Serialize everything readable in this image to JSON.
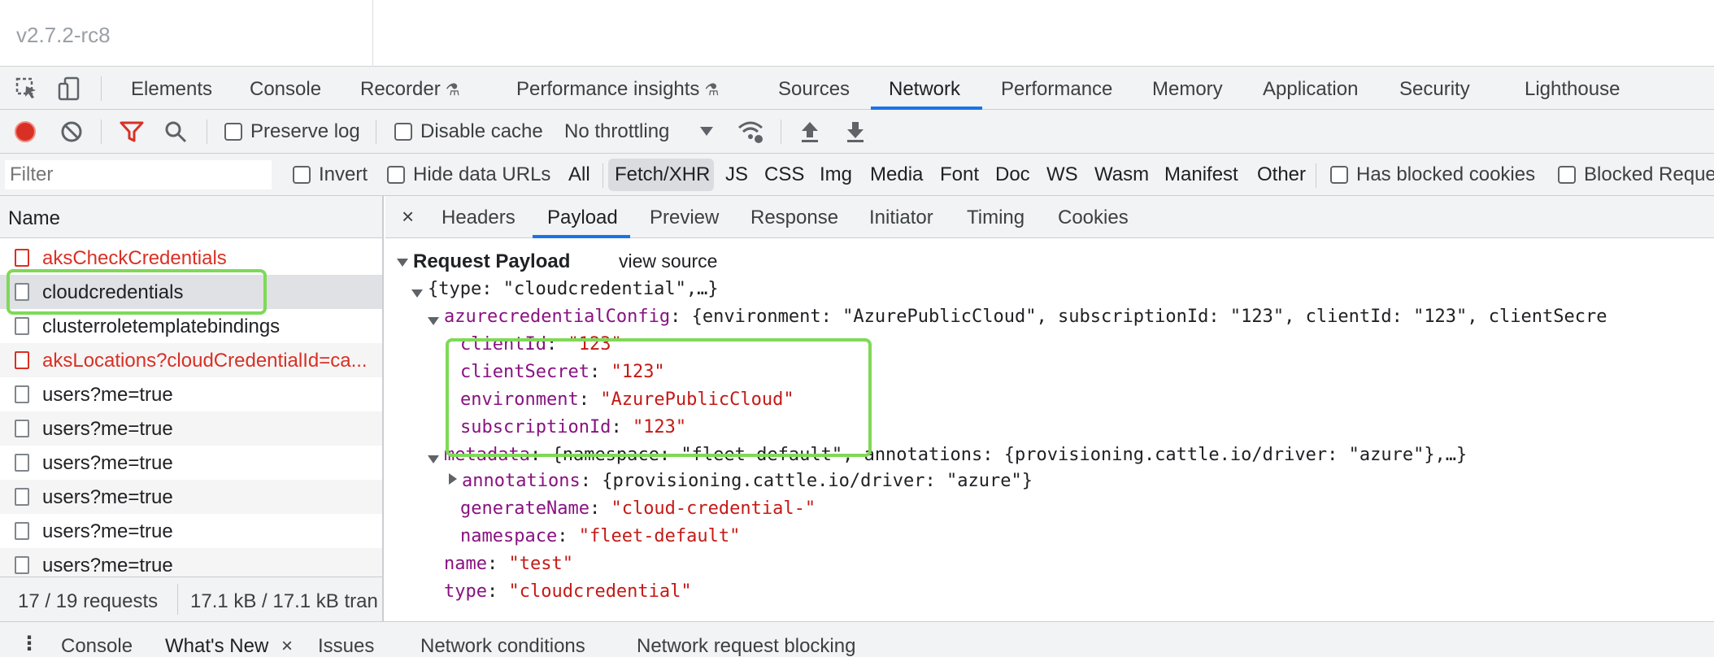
{
  "page": {
    "version": "v2.7.2-rc8"
  },
  "main_tabs": {
    "items": [
      "Elements",
      "Console",
      "Recorder",
      "Performance insights",
      "Sources",
      "Network",
      "Performance",
      "Memory",
      "Application",
      "Security",
      "Lighthouse"
    ],
    "active": "Network"
  },
  "toolbar": {
    "preserve_log": "Preserve log",
    "disable_cache": "Disable cache",
    "throttling": "No throttling"
  },
  "filter": {
    "placeholder": "Filter",
    "invert": "Invert",
    "hide_data_urls": "Hide data URLs",
    "types": [
      "All",
      "Fetch/XHR",
      "JS",
      "CSS",
      "Img",
      "Media",
      "Font",
      "Doc",
      "WS",
      "Wasm",
      "Manifest",
      "Other"
    ],
    "active_type": "Fetch/XHR",
    "has_blocked_cookies": "Has blocked cookies",
    "blocked_requests": "Blocked Reque"
  },
  "requests": {
    "header": "Name",
    "rows": [
      {
        "name": "aksCheckCredentials",
        "error": true
      },
      {
        "name": "cloudcredentials",
        "selected": true
      },
      {
        "name": "clusterroletemplatebindings"
      },
      {
        "name": "aksLocations?cloudCredentialId=ca...",
        "error": true
      },
      {
        "name": "users?me=true"
      },
      {
        "name": "users?me=true"
      },
      {
        "name": "users?me=true"
      },
      {
        "name": "users?me=true"
      },
      {
        "name": "users?me=true"
      },
      {
        "name": "users?me=true"
      }
    ],
    "status_count": "17 / 19 requests",
    "status_size": "17.1 kB / 17.1 kB tran"
  },
  "detail_tabs": {
    "close": "×",
    "items": [
      "Headers",
      "Payload",
      "Preview",
      "Response",
      "Initiator",
      "Timing",
      "Cookies"
    ],
    "active": "Payload"
  },
  "payload": {
    "title": "Request Payload",
    "view_source": "view source",
    "root_summary": "{type: \"cloudcredential\",…}",
    "azure_key": "azurecredentialConfig",
    "azure_summary": ": {environment: \"AzurePublicCloud\", subscriptionId: \"123\", clientId: \"123\", clientSecre",
    "azure_fields": [
      {
        "key": "clientId",
        "value": "\"123\""
      },
      {
        "key": "clientSecret",
        "value": "\"123\""
      },
      {
        "key": "environment",
        "value": "\"AzurePublicCloud\""
      },
      {
        "key": "subscriptionId",
        "value": "\"123\""
      }
    ],
    "metadata_key": "metadata",
    "metadata_summary": ": {namespace: \"fleet-default\", annotations: {provisioning.cattle.io/driver: \"azure\"},…}",
    "annotations_key": "annotations",
    "annotations_summary": ": {provisioning.cattle.io/driver: \"azure\"}",
    "generate_name_key": "generateName",
    "generate_name_value": "\"cloud-credential-\"",
    "namespace_key": "namespace",
    "namespace_value": "\"fleet-default\"",
    "name_key": "name",
    "name_value": "\"test\"",
    "type_key": "type",
    "type_value": "\"cloudcredential\""
  },
  "drawer": {
    "items": [
      "Console",
      "What's New",
      "Issues",
      "Network conditions",
      "Network request blocking"
    ],
    "active": "What's New",
    "close": "×"
  },
  "colors": {
    "accent": "#1a73e8",
    "error": "#d93025",
    "highlight": "#7ed957",
    "json_key": "#881280",
    "json_string": "#c41a16"
  }
}
